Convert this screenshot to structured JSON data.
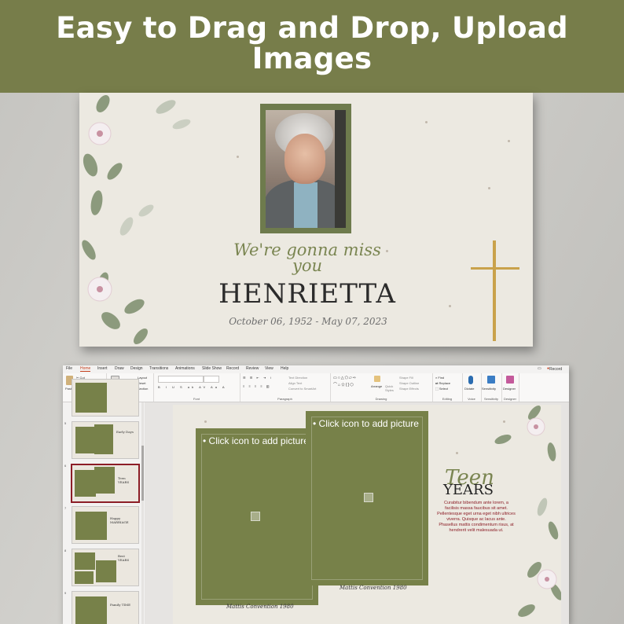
{
  "header": {
    "title": "Easy to Drag and Drop, Upload Images",
    "bg": "#777d4a"
  },
  "memorial_slide": {
    "tagline": "We're gonna miss you",
    "name": "HENRIETTA",
    "dates": "October 06, 1952 - May 07, 2023",
    "frame_color": "#6e7b4d",
    "cross_color": "#c9a24b"
  },
  "ppt": {
    "tabs": [
      "File",
      "Home",
      "Insert",
      "Draw",
      "Design",
      "Transitions",
      "Animations",
      "Slide Show",
      "Record",
      "Review",
      "View",
      "Help"
    ],
    "active_tab": "Home",
    "record_label": "Record",
    "ribbon_groups": [
      "Clipboard",
      "Slides",
      "Font",
      "Paragraph",
      "Drawing",
      "Editing",
      "Voice",
      "Sensitivity",
      "Designer"
    ],
    "clipboard": {
      "paste": "Paste",
      "cut": "Cut",
      "copy": "Copy",
      "format_painter": "Format Painter"
    },
    "slides_group": {
      "new_slide": "New Slide",
      "reuse": "Reuse Slides",
      "layout": "Layout",
      "reset": "Reset",
      "section": "Section"
    },
    "editing": {
      "find": "Find",
      "replace": "Replace",
      "select": "Select"
    },
    "voice": {
      "dictate": "Dictate"
    },
    "sensitivity": {
      "label": "Sensitivity"
    },
    "designer": {
      "label": "Designer"
    },
    "drawing": {
      "arrange": "Arrange",
      "quick_styles": "Quick Styles",
      "shape_fill": "Shape Fill",
      "shape_outline": "Shape Outline",
      "shape_effects": "Shape Effects"
    },
    "paragraph": {
      "text_direction": "Text Direction",
      "align_text": "Align Text",
      "smartart": "Convert to SmartArt"
    },
    "thumbnails": [
      {
        "num": "",
        "title": ""
      },
      {
        "num": "5",
        "title": "Early Days"
      },
      {
        "num": "6",
        "title": "Teen YEARS"
      },
      {
        "num": "7",
        "title": "Happy MARRIAGE"
      },
      {
        "num": "8",
        "title": "Best YEARS"
      },
      {
        "num": "9",
        "title": "Family TIME"
      }
    ],
    "selected_thumbnail": 2,
    "editing_slide": {
      "placeholder1": "Click icon to add picture",
      "placeholder2": "Click icon to add picture",
      "caption1": "Mattis Convention 1980",
      "caption2": "Mattis Convention 1980",
      "title_script": "Teen",
      "title_caps": "YEARS",
      "paragraph": "Curabitur bibendum ante lorem, a facilisis massa faucibus sit amet. Pellentesque eget urna eget nibh ultrices viverra. Quisque ac lacus ante. Phasellus mattis condimentum risus, at hendrerit velit malesuada ut."
    }
  }
}
